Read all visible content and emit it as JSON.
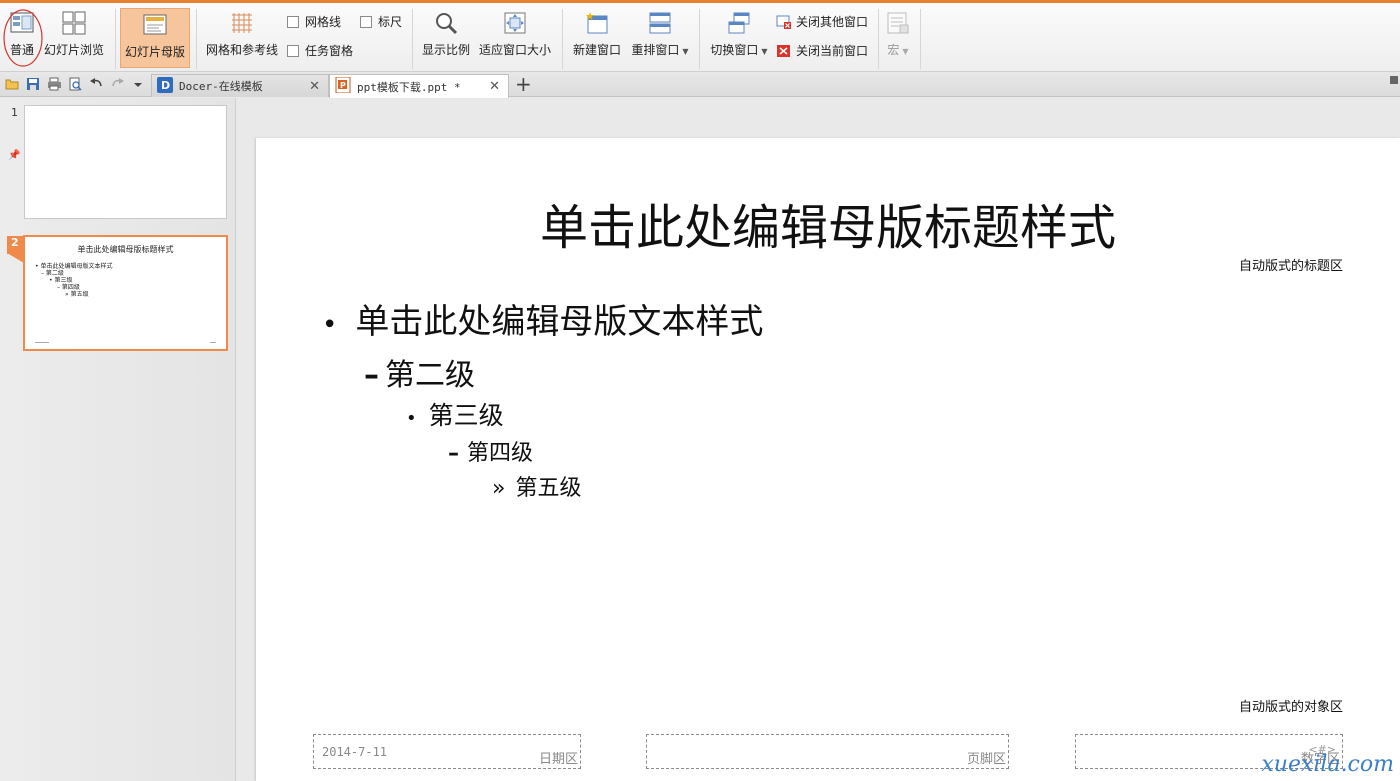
{
  "ribbon": {
    "normal": "普通",
    "slide_sorter": "幻灯片浏览",
    "slide_master": "幻灯片母版",
    "grid_guides": "网格和参考线",
    "gridlines": "网格线",
    "ruler": "标尺",
    "task_pane": "任务窗格",
    "zoom": "显示比例",
    "fit_window": "适应窗口大小",
    "new_window": "新建窗口",
    "arrange_windows": "重排窗口",
    "switch_window": "切换窗口",
    "close_others": "关闭其他窗口",
    "close_current": "关闭当前窗口",
    "macro": "宏"
  },
  "tabs": [
    {
      "label": "Docer-在线模板",
      "close": "✕"
    },
    {
      "label": "ppt模板下载.ppt *",
      "close": "✕"
    }
  ],
  "new_tab": "+",
  "thumbnails": [
    {
      "number": "1"
    },
    {
      "number": "2",
      "title": "单击此处编辑母版标题样式",
      "lines": [
        "• 单击此处编辑母版文本样式",
        "– 第二级",
        "• 第三级",
        "– 第四级",
        "» 第五级"
      ]
    }
  ],
  "slide": {
    "title": "单击此处编辑母版标题样式",
    "title_area_label": "自动版式的标题区",
    "bullets": [
      {
        "marker": "•",
        "text": "单击此处编辑母版文本样式"
      },
      {
        "marker": "–",
        "text": "第二级"
      },
      {
        "marker": "•",
        "text": "第三级"
      },
      {
        "marker": "–",
        "text": "第四级"
      },
      {
        "marker": "»",
        "text": "第五级"
      }
    ],
    "object_area_label": "自动版式的对象区",
    "date_value": "2014-7-11",
    "date_label": "日期区",
    "footer_label": "页脚区",
    "number_value": "<#>",
    "number_label": "数字区"
  },
  "watermark": "xuexila.com",
  "colors": {
    "accent": "#e8812e",
    "active_button": "#f6c59b"
  }
}
